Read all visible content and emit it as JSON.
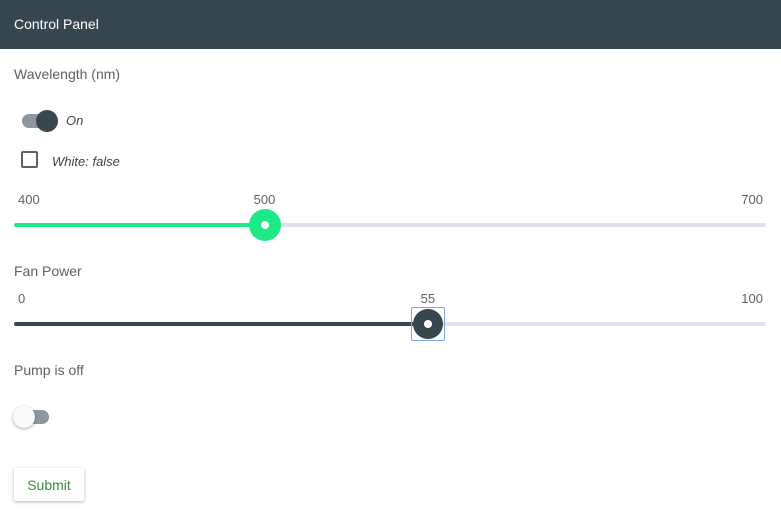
{
  "header": {
    "title": "Control Panel"
  },
  "wavelength": {
    "label": "Wavelength (nm)",
    "toggle": {
      "state": true,
      "label": "On"
    },
    "white_checkbox": {
      "checked": false,
      "label": "White: false"
    },
    "slider": {
      "min": 400,
      "max": 700,
      "value": 500,
      "min_label": "400",
      "max_label": "700",
      "value_label": "500",
      "color": "#1de986"
    }
  },
  "fan": {
    "label": "Fan Power",
    "slider": {
      "min": 0,
      "max": 100,
      "value": 55,
      "min_label": "0",
      "max_label": "100",
      "value_label": "55",
      "color": "#37474f"
    }
  },
  "pump": {
    "label": "Pump is off",
    "toggle": {
      "state": false
    }
  },
  "submit": {
    "label": "Submit"
  },
  "colors": {
    "header_bg": "#37474f",
    "accent_green": "#1de986",
    "submit_text": "#388e3c"
  },
  "icons": {
    "toggle": "toggle-switch",
    "checkbox": "checkbox-unchecked",
    "thumb": "slider-thumb"
  }
}
